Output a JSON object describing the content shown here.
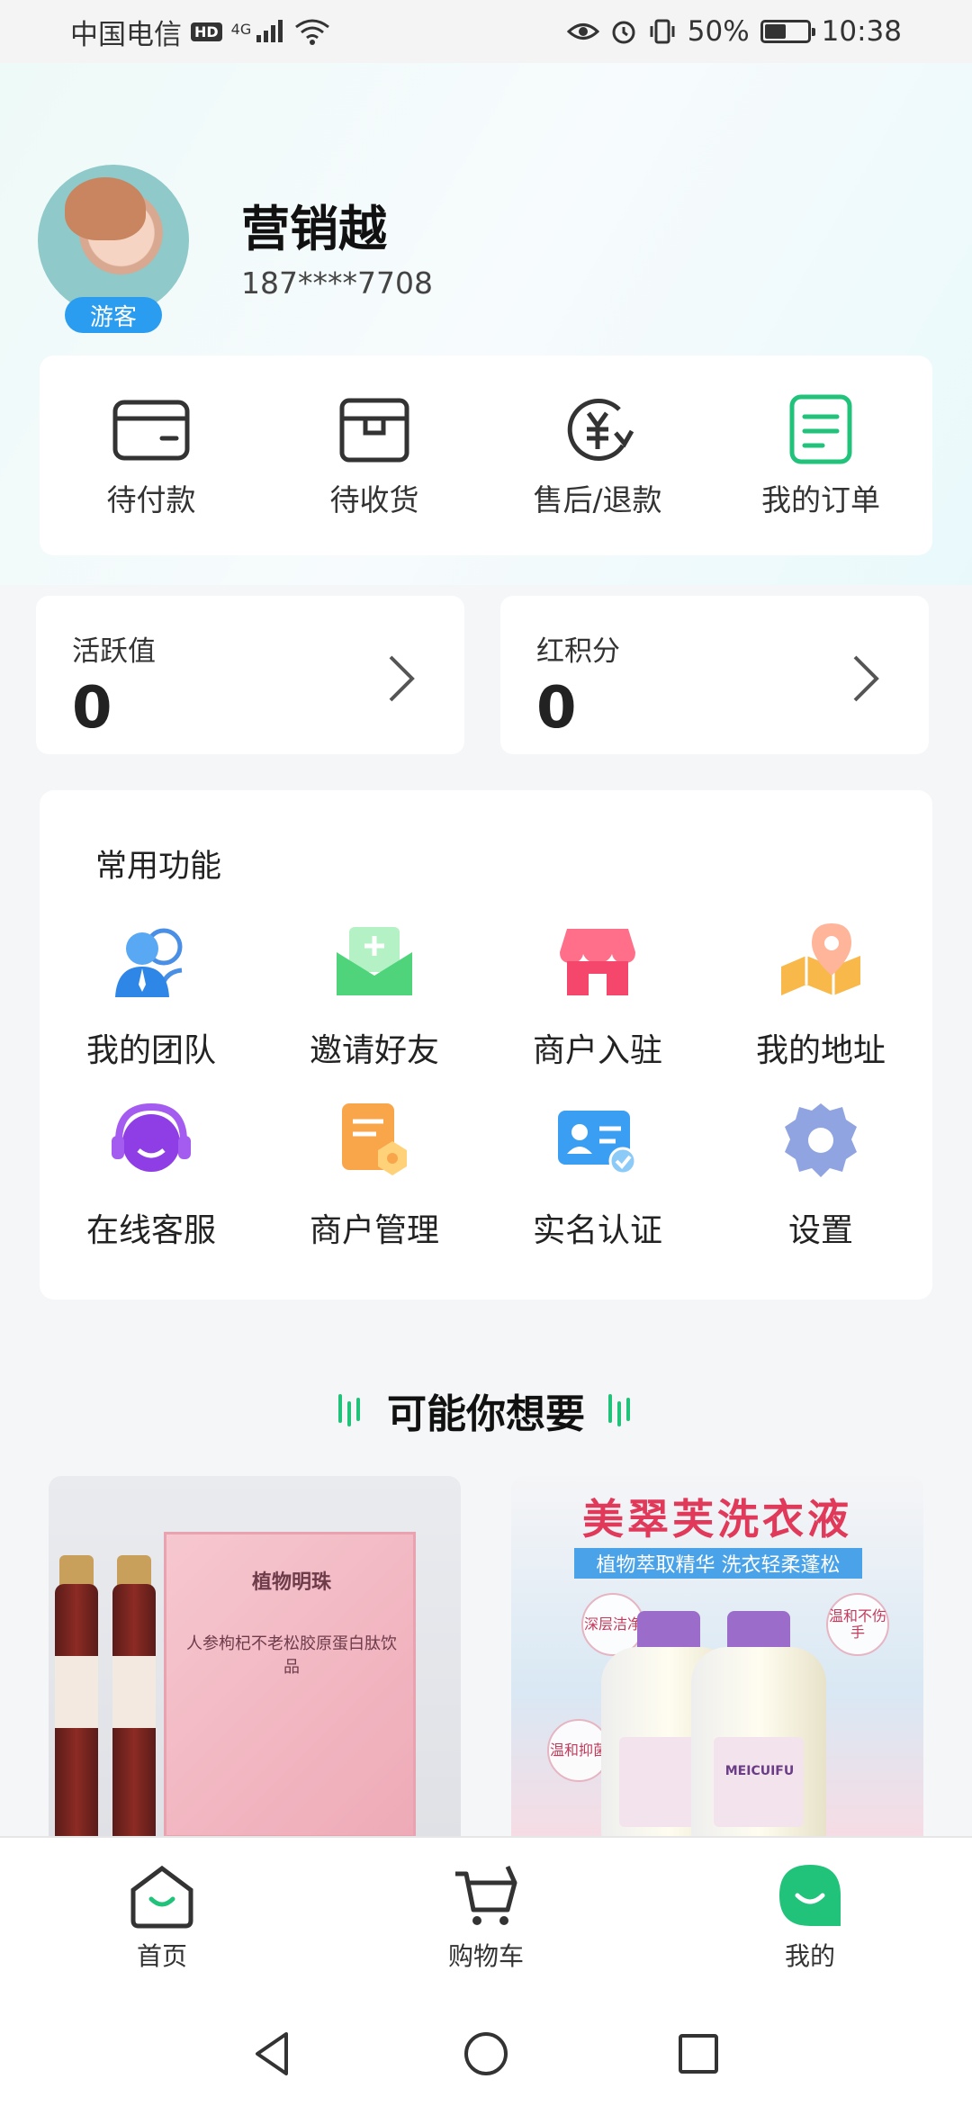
{
  "status_bar": {
    "carrier": "中国电信",
    "hd": "HD",
    "network": "4G",
    "battery_percent": "50%",
    "battery_level": 0.5,
    "time": "10:38"
  },
  "profile": {
    "name": "营销越",
    "phone": "187****7708",
    "badge": "游客"
  },
  "orders": [
    {
      "label": "待付款",
      "icon": "wallet-icon"
    },
    {
      "label": "待收货",
      "icon": "package-icon"
    },
    {
      "label": "售后/退款",
      "icon": "refund-yen-icon"
    },
    {
      "label": "我的订单",
      "icon": "order-list-icon"
    }
  ],
  "stats": [
    {
      "title": "活跃值",
      "value": "0"
    },
    {
      "title": "红积分",
      "value": "0"
    }
  ],
  "functions": {
    "title": "常用功能",
    "items": [
      {
        "label": "我的团队",
        "icon": "team-icon"
      },
      {
        "label": "邀请好友",
        "icon": "invite-mail-icon"
      },
      {
        "label": "商户入驻",
        "icon": "store-icon"
      },
      {
        "label": "我的地址",
        "icon": "map-pin-icon"
      },
      {
        "label": "在线客服",
        "icon": "headset-icon"
      },
      {
        "label": "商户管理",
        "icon": "merchant-manage-icon"
      },
      {
        "label": "实名认证",
        "icon": "id-card-icon"
      },
      {
        "label": "设置",
        "icon": "gear-icon"
      }
    ]
  },
  "recommend": {
    "title": "可能你想要",
    "products": [
      {
        "box_brand": "植物明珠",
        "box_text": "人参枸杞不老松胶原蛋白肽饮品"
      },
      {
        "headline": "美翠芙洗衣液",
        "subline": "植物萃取精华 洗衣轻柔蓬松",
        "seals": [
          "深层洁净",
          "温和不伤手",
          "温和抑菌"
        ],
        "brand": "MEICUIFU"
      }
    ]
  },
  "tabs": [
    {
      "label": "首页",
      "icon": "home-icon"
    },
    {
      "label": "购物车",
      "icon": "cart-icon"
    },
    {
      "label": "我的",
      "icon": "profile-smile-icon",
      "active": true
    }
  ],
  "colors": {
    "accent_green": "#21c27a",
    "badge_blue": "#2b9df0"
  }
}
